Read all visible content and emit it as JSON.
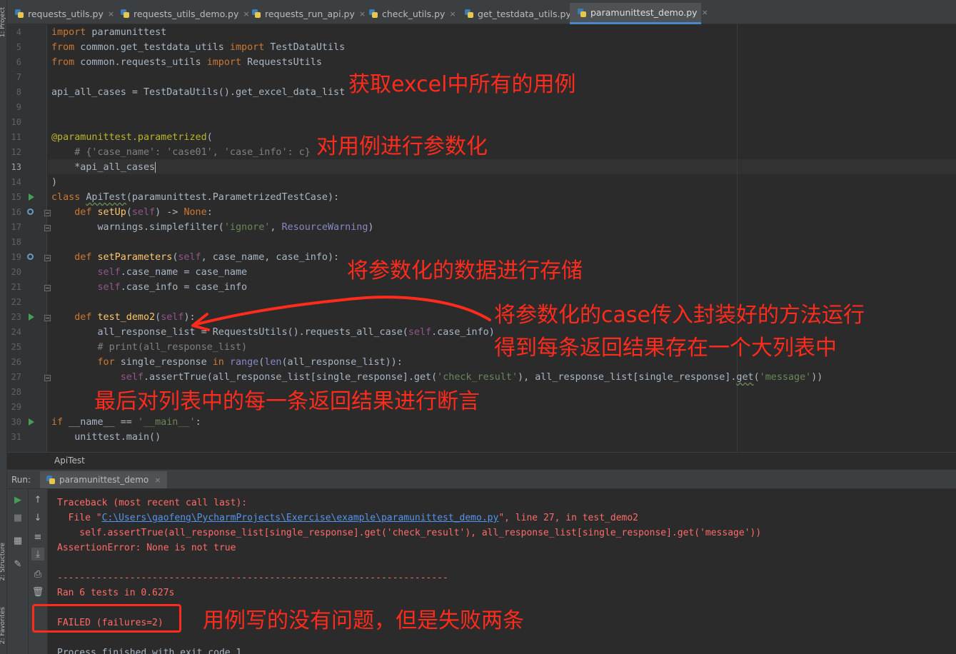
{
  "strip": {
    "project": "1: Project",
    "structure": "2: Structure",
    "favorites": "2: Favorites"
  },
  "tabs": [
    {
      "label": "requests_utils.py"
    },
    {
      "label": "requests_utils_demo.py"
    },
    {
      "label": "requests_run_api.py"
    },
    {
      "label": "check_utils.py"
    },
    {
      "label": "get_testdata_utils.py"
    },
    {
      "label": "paramunittest_demo.py"
    }
  ],
  "tab_close": "×",
  "editor": {
    "current_line": "13",
    "line_numbers": [
      "4",
      "5",
      "6",
      "7",
      "8",
      "9",
      "10",
      "11",
      "12",
      "13",
      "14",
      "15",
      "16",
      "17",
      "18",
      "19",
      "20",
      "21",
      "22",
      "23",
      "24",
      "25",
      "26",
      "27",
      "28",
      "29",
      "30",
      "31"
    ]
  },
  "code": {
    "l4_kw": "import",
    "l4_rest": " paramunittest",
    "l5_kw": "from",
    "l5_mod": " common.get_testdata_utils ",
    "l5_kw2": "import",
    "l5_rest": " TestDataUtils",
    "l6_kw": "from",
    "l6_mod": " common.requests_utils ",
    "l6_kw2": "import",
    "l6_rest": " RequestsUtils",
    "l8": "api_all_cases = TestDataUtils().get_excel_data_list",
    "l11_dec": "@paramunittest.parametrized",
    "l11_rest": "(",
    "l12_comment": "    # {'case_name': 'case01', 'case_info': c}",
    "l13": "    *api_all_cases",
    "l14": ")",
    "l15_kw": "class",
    "l15_name": "ApiTest",
    "l15_rest": "(paramunittest.ParametrizedTestCase):",
    "l16_kw": "    def",
    "l16_fn": " setUp",
    "l16_open": "(",
    "l16_self": "self",
    "l16_mid": ") -> ",
    "l16_none": "None",
    "l16_end": ":",
    "l17_pre": "        warnings.simplefilter(",
    "l17_str": "'ignore'",
    "l17_mid": ", ",
    "l17_bi": "ResourceWarning",
    "l17_end": ")",
    "l19_kw": "    def",
    "l19_fn": " setParameters",
    "l19_open": "(",
    "l19_self": "self",
    "l19_rest": ", case_name, case_info):",
    "l20_self": "        self",
    "l20_rest": ".case_name = case_name",
    "l21_self": "        self",
    "l21_rest": ".case_info = case_info",
    "l23_kw": "    def",
    "l23_fn": " test_demo2",
    "l23_open": "(",
    "l23_self": "self",
    "l23_end": "):",
    "l24_pre": "        all_response_list = RequestsUtils().requests_all_case(",
    "l24_self": "self",
    "l24_rest": ".case_info)",
    "l25_comment": "        # print(all_response_list)",
    "l26_kw": "        for",
    "l26_mid": " single_response ",
    "l26_kw2": "in",
    "l26_bi": " range",
    "l26_open": "(",
    "l26_bi2": "len",
    "l26_rest": "(all_response_list)):",
    "l27_self": "            self",
    "l27_pre": ".assertTrue(all_response_list[single_response].get(",
    "l27_str1": "'check_result'",
    "l27_mid": "), all_response_list[single_response].",
    "l27_get": "get",
    "l27_open": "(",
    "l27_str2": "'message'",
    "l27_end": "))",
    "l30_kw": "if",
    "l30_mid": " __name__ == ",
    "l30_str": "'__main__'",
    "l30_end": ":",
    "l31": "    unittest.main()"
  },
  "breadcrumb": "ApiTest",
  "run": {
    "title": "Run:",
    "tab_label": "paramunittest_demo",
    "tab_close": "×"
  },
  "console": {
    "line1": "Traceback (most recent call last):",
    "line2_pre": "  File \"",
    "line2_link": "C:\\Users\\gaofeng\\PycharmProjects\\Exercise\\example\\paramunittest_demo.py",
    "line2_post": "\", line 27, in test_demo2",
    "line3": "    self.assertTrue(all_response_list[single_response].get('check_result'), all_response_list[single_response].get('message'))",
    "line4": "AssertionError: None is not true",
    "separator": "----------------------------------------------------------------------",
    "ran": "Ran 6 tests in 0.627s",
    "failed": "FAILED (failures=2)",
    "exit": "Process finished with exit code 1"
  },
  "annotations": {
    "a1": "获取excel中所有的用例",
    "a2": "对用例进行参数化",
    "a3": "将参数化的数据进行存储",
    "a4_l1": "将参数化的case传入封装好的方法运行",
    "a4_l2": "得到每条返回结果存在一个大列表中",
    "a5": "最后对列表中的每一条返回结果进行断言",
    "a6": "用例写的没有问题，但是失败两条"
  },
  "colors": {
    "annotation": "#ff2b1c",
    "keyword": "#cc7832",
    "string": "#6a8759",
    "error": "#ff6b68",
    "link": "#5394ec"
  }
}
